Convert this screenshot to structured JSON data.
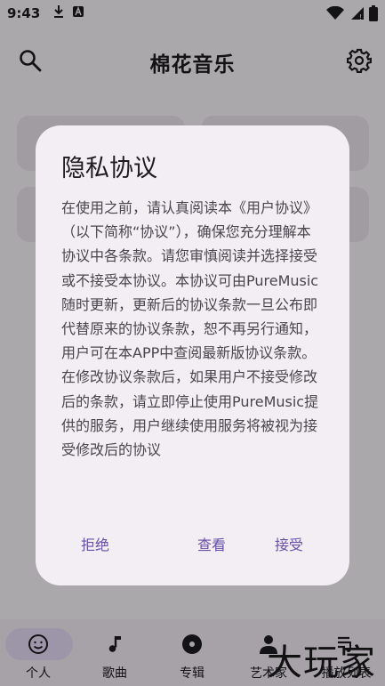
{
  "status_bar": {
    "time": "9:43"
  },
  "app_bar": {
    "title": "棉花音乐"
  },
  "bottom_nav": [
    {
      "label": "个人",
      "icon": "person-icon",
      "selected": true
    },
    {
      "label": "歌曲",
      "icon": "music-note-icon",
      "selected": false
    },
    {
      "label": "专辑",
      "icon": "album-icon",
      "selected": false
    },
    {
      "label": "艺术家",
      "icon": "artist-icon",
      "selected": false
    },
    {
      "label": "播放列表",
      "icon": "playlist-icon",
      "selected": false
    }
  ],
  "dialog": {
    "title": "隐私协议",
    "body": "在使用之前，请认真阅读本《用户协议》（以下简称“协议”），确保您充分理解本协议中各条款。请您审慎阅读并选择接受或不接受本协议。本协议可由PureMusic随时更新，更新后的协议条款一旦公布即代替原来的协议条款，恕不再另行通知，用户可在本APP中查阅最新版协议条款。在修改协议条款后，如果用户不接受修改后的条款，请立即停止使用PureMusic提供的服务，用户继续使用服务将被视为接受修改后的协议",
    "buttons": {
      "reject": "拒绝",
      "view": "查看",
      "accept": "接受"
    }
  },
  "watermark": "大玩家",
  "colors": {
    "accent": "#6750a4",
    "scrim": "rgba(0,0,0,0.32)",
    "dialog_bg": "#f2eef3",
    "nav_pill": "#e8def8"
  }
}
